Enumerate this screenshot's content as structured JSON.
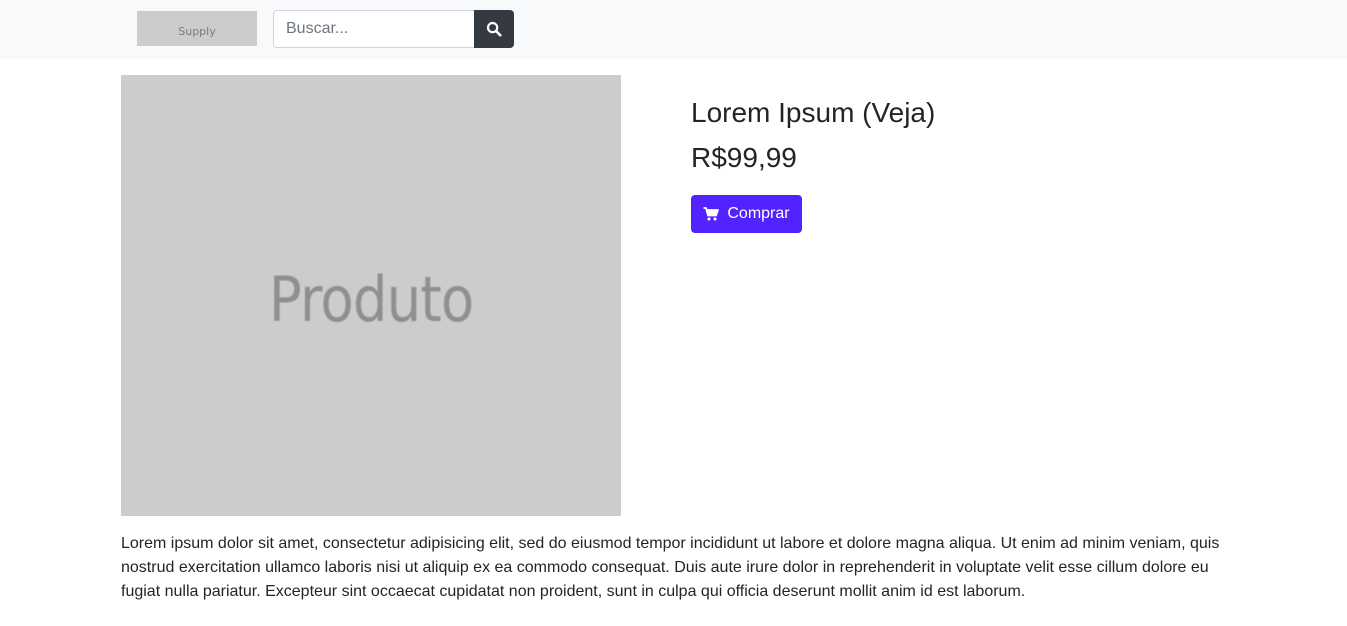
{
  "header": {
    "logo_text": "Supply",
    "search": {
      "placeholder": "Buscar...",
      "value": "",
      "button_icon": "search-icon"
    }
  },
  "product": {
    "image_label": "Produto",
    "title": "Lorem Ipsum (Veja)",
    "price": "R$99,99",
    "buy_button": {
      "label": "Comprar",
      "icon": "cart-icon"
    },
    "description": "Lorem ipsum dolor sit amet, consectetur adipisicing elit, sed do eiusmod tempor incididunt ut labore et dolore magna aliqua. Ut enim ad minim veniam, quis nostrud exercitation ullamco laboris nisi ut aliquip ex ea commodo consequat. Duis aute irure dolor in reprehenderit in voluptate velit esse cillum dolore eu fugiat nulla pariatur. Excepteur sint occaecat cupidatat non proident, sunt in culpa qui officia deserunt mollit anim id est laborum."
  },
  "colors": {
    "navbar_bg": "#f8f9fa",
    "search_button_bg": "#343a40",
    "buy_button_bg": "#5222ff",
    "placeholder_bg": "#cccccc"
  }
}
